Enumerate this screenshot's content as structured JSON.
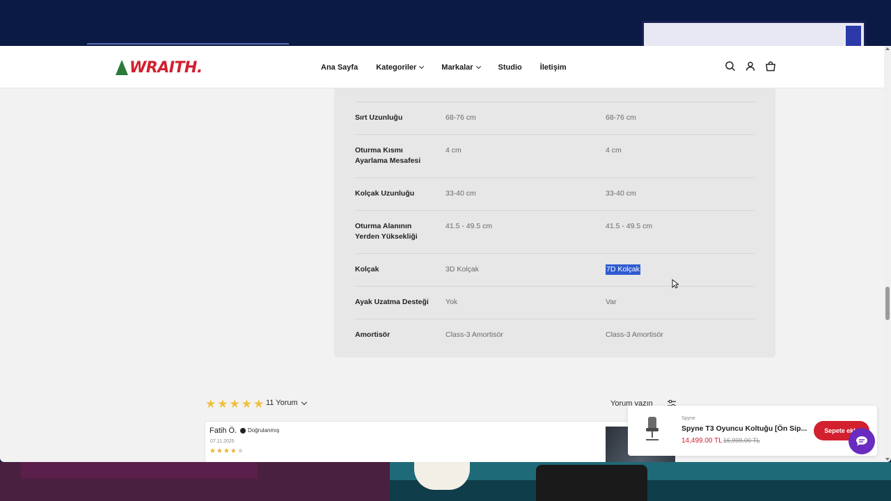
{
  "header": {
    "logo_text": "WRAITH.",
    "nav": [
      {
        "label": "Ana Sayfa"
      },
      {
        "label": "Kategoriler"
      },
      {
        "label": "Markalar"
      },
      {
        "label": "Studio"
      },
      {
        "label": "İletişim"
      }
    ]
  },
  "specs": {
    "rows": [
      {
        "label": "Sırt Uzunluğu",
        "value_1": "68-76 cm",
        "value_2": "68-76 cm"
      },
      {
        "label": "Oturma Kısmı Ayarlama Mesafesi",
        "value_1": "4 cm",
        "value_2": "4 cm"
      },
      {
        "label": "Kolçak Uzunluğu",
        "value_1": "33-40 cm",
        "value_2": "33-40 cm"
      },
      {
        "label": "Oturma Alanının Yerden Yüksekliği",
        "value_1": "41.5 - 49.5 cm",
        "value_2": "41.5 - 49.5 cm"
      },
      {
        "label": "Kolçak",
        "value_1": "3D Kolçak",
        "value_2": "7D Kolçak"
      },
      {
        "label": "Ayak Uzatma Desteği",
        "value_1": "Yok",
        "value_2": "Var"
      },
      {
        "label": "Amortisör",
        "value_1": "Class-3 Amortisör",
        "value_2": "Class-3 Amortisör"
      }
    ]
  },
  "reviews": {
    "rating": 5,
    "count_label": "11 Yorum",
    "write_label": "Yorum yazın",
    "items": [
      {
        "name": "Fatih Ö.",
        "verified_label": "Doğrulanmış",
        "date": "07.11.2025",
        "rating": 4
      }
    ]
  },
  "sticky": {
    "brand": "Spyne",
    "title": "Spyne T3 Oyuncu Koltuğu [Ön Sip...",
    "price": "14,499.00 TL",
    "old_price": "16,999.00 TL",
    "button_label": "Sepete ekle"
  },
  "colors": {
    "brand_red": "#d2202e",
    "selection_blue": "#2f5bd1",
    "chat_purple": "#6a2bbf",
    "star_gold": "#f0c03a"
  }
}
